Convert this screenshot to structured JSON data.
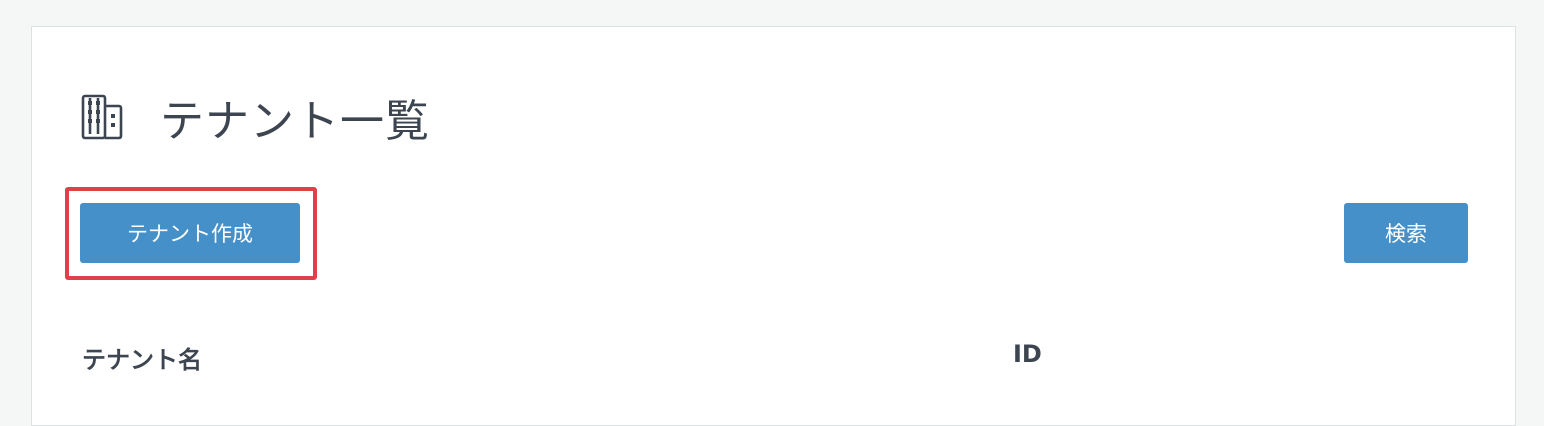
{
  "page": {
    "title": "テナント一覧",
    "title_icon": "building-icon"
  },
  "toolbar": {
    "create_label": "テナント作成",
    "search_label": "検索"
  },
  "table": {
    "columns": [
      "テナント名",
      "ID"
    ]
  },
  "colors": {
    "background": "#f5f6f6",
    "panel": "#ffffff",
    "primary_button": "#4590c9",
    "highlight_border": "#e0404a",
    "text": "#3d4650"
  }
}
